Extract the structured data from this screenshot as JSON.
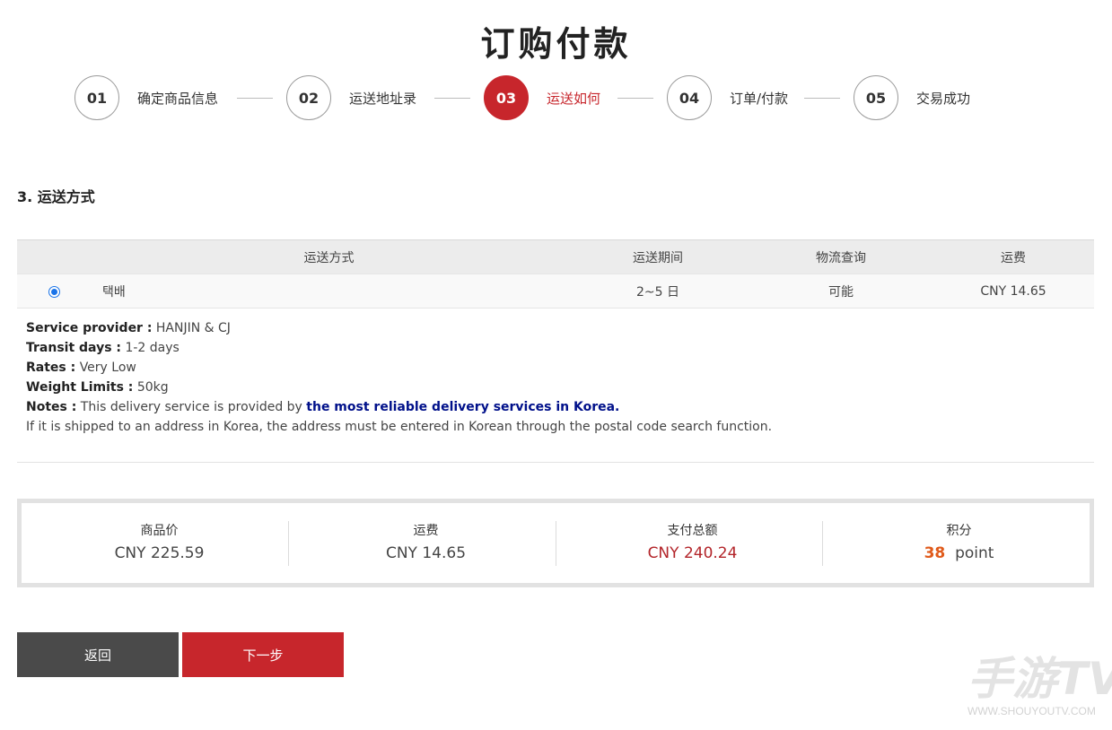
{
  "page": {
    "title": "订购付款"
  },
  "steps": [
    {
      "num": "01",
      "label": "确定商品信息"
    },
    {
      "num": "02",
      "label": "运送地址录"
    },
    {
      "num": "03",
      "label": "运送如何"
    },
    {
      "num": "04",
      "label": "订单/付款"
    },
    {
      "num": "05",
      "label": "交易成功"
    }
  ],
  "section": {
    "title": "3. 运送方式"
  },
  "shipping_table": {
    "headers": [
      "运送方式",
      "运送期间",
      "物流查询",
      "运费"
    ],
    "row": {
      "method": "택배",
      "period": "2~5 日",
      "tracking": "可能",
      "fee": "CNY 14.65"
    }
  },
  "details": {
    "provider_label": "Service provider :",
    "provider_value": "HANJIN & CJ",
    "transit_label": "Transit days :",
    "transit_value": "1-2 days",
    "rates_label": "Rates :",
    "rates_value": "Very Low",
    "weight_label": "Weight Limits :",
    "weight_value": "50kg",
    "notes_label": "Notes :",
    "notes_value": "This delivery service is provided by ",
    "notes_highlight": "the most reliable delivery services in Korea.",
    "korea_note": "If it is shipped to an address in Korea, the address must be entered in Korean through the postal code search function."
  },
  "summary": {
    "product_label": "商品价",
    "product_value": "CNY 225.59",
    "shipping_label": "运费",
    "shipping_value": "CNY 14.65",
    "total_label": "支付总额",
    "total_value": "CNY 240.24",
    "points_label": "积分",
    "points_value": "38",
    "points_unit": "point"
  },
  "buttons": {
    "back": "返回",
    "next": "下一步"
  },
  "watermark": {
    "logo": "手游TV",
    "url": "WWW.SHOUYOUTV.COM"
  },
  "colors": {
    "accent": "#c7262c",
    "highlight_text": "#00108a",
    "points": "#e05a1a"
  }
}
